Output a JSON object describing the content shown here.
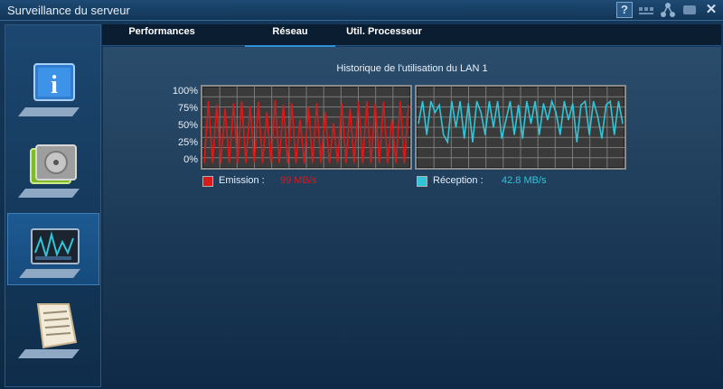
{
  "window": {
    "title": "Surveillance du serveur"
  },
  "titlebar_icons": [
    "help-icon",
    "network-icon",
    "hierarchy-icon",
    "minimize-icon",
    "close-icon"
  ],
  "tabs": [
    {
      "label": "Performances",
      "active": false
    },
    {
      "label": "Réseau",
      "active": true
    },
    {
      "label": "Util. Processeur",
      "active": false
    }
  ],
  "sidebar": {
    "items": [
      {
        "name": "info",
        "icon": "info-icon"
      },
      {
        "name": "storage",
        "icon": "storage-icon"
      },
      {
        "name": "monitor",
        "icon": "monitor-icon",
        "active": true
      },
      {
        "name": "log",
        "icon": "log-icon"
      }
    ]
  },
  "network": {
    "chart_title": "Historique de l'utilisation du LAN 1",
    "y_ticks": [
      "100%",
      "75%",
      "50%",
      "25%",
      "0%"
    ],
    "emission_label": "Emission :",
    "emission_value": "99 MB/s",
    "reception_label": "Réception :",
    "reception_value": "42.8 MB/s",
    "colors": {
      "emission": "#d81a1a",
      "reception": "#2ec6d8"
    }
  },
  "chart_data": [
    {
      "type": "line",
      "title": "",
      "series": [
        {
          "name": "Emission",
          "values": [
            2,
            85,
            2,
            80,
            2,
            75,
            2,
            82,
            2,
            85,
            2,
            78,
            2,
            84,
            2,
            70,
            2,
            86,
            2,
            80,
            2,
            82,
            2,
            60,
            2,
            78,
            2,
            82,
            2,
            70,
            2,
            55,
            2,
            82,
            2,
            75,
            2,
            84,
            2,
            85,
            2,
            82,
            2,
            84,
            2,
            60,
            2,
            85,
            2,
            80
          ]
        }
      ],
      "ylim": [
        0,
        100
      ]
    },
    {
      "type": "line",
      "title": "",
      "series": [
        {
          "name": "Réception",
          "values": [
            55,
            85,
            40,
            85,
            70,
            80,
            40,
            30,
            85,
            50,
            85,
            35,
            82,
            30,
            85,
            70,
            40,
            85,
            50,
            85,
            35,
            60,
            85,
            40,
            80,
            35,
            85,
            55,
            85,
            40,
            82,
            60,
            85,
            70,
            40,
            85,
            60,
            82,
            30,
            80,
            85,
            40,
            85,
            65,
            35,
            80,
            85,
            40,
            85,
            55
          ]
        }
      ],
      "ylim": [
        0,
        100
      ]
    }
  ]
}
